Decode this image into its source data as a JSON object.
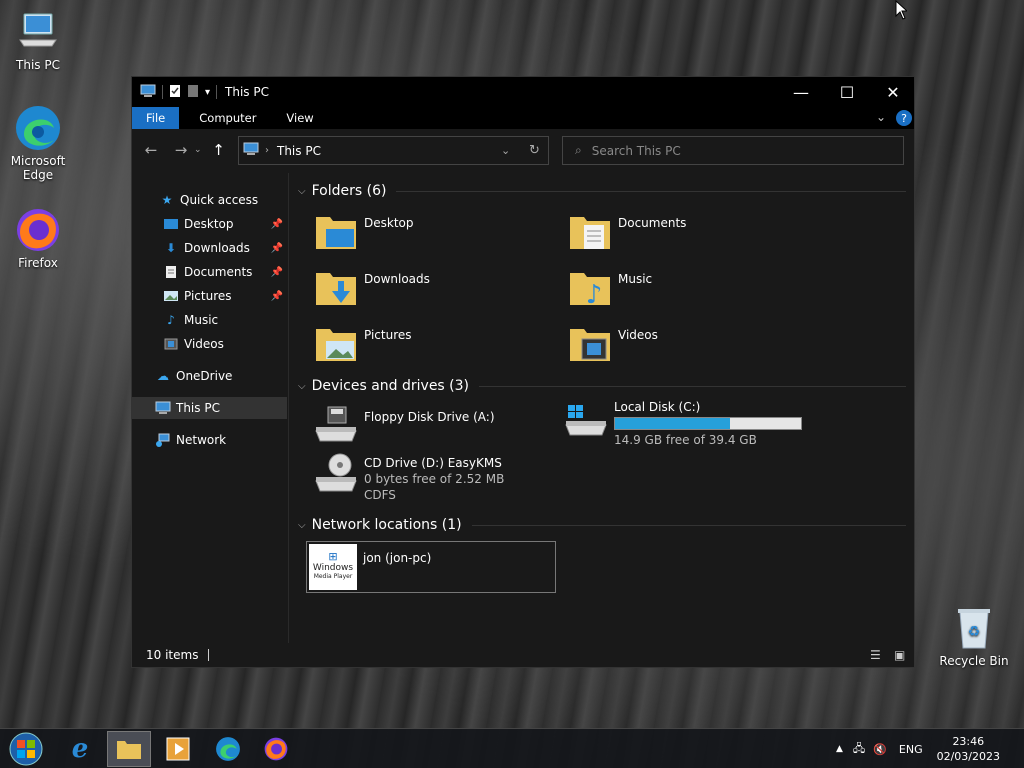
{
  "desktop": {
    "icons": [
      {
        "label": "This PC"
      },
      {
        "label": "Microsoft Edge"
      },
      {
        "label": "Firefox"
      },
      {
        "label": "Recycle Bin"
      }
    ]
  },
  "window": {
    "title": "This PC",
    "tabs": [
      "File",
      "Computer",
      "View"
    ],
    "address": "This PC",
    "search_placeholder": "Search This PC"
  },
  "nav": {
    "quick_access": "Quick access",
    "items": [
      {
        "label": "Desktop",
        "pinned": true
      },
      {
        "label": "Downloads",
        "pinned": true
      },
      {
        "label": "Documents",
        "pinned": true
      },
      {
        "label": "Pictures",
        "pinned": true
      },
      {
        "label": "Music",
        "pinned": false
      },
      {
        "label": "Videos",
        "pinned": false
      }
    ],
    "onedrive": "OneDrive",
    "this_pc": "This PC",
    "network": "Network"
  },
  "content": {
    "folders_header": "Folders (6)",
    "folders": [
      "Desktop",
      "Documents",
      "Downloads",
      "Music",
      "Pictures",
      "Videos"
    ],
    "devices_header": "Devices and drives (3)",
    "devices": [
      {
        "name": "Floppy Disk Drive (A:)"
      },
      {
        "name": "Local Disk (C:)",
        "free": "14.9 GB free of 39.4 GB",
        "used_fraction": 0.62
      },
      {
        "name": "CD Drive (D:) EasyKMS",
        "free": "0 bytes free of 2.52 MB",
        "fs": "CDFS"
      }
    ],
    "network_header": "Network locations (1)",
    "network": [
      {
        "name": "jon (jon-pc)",
        "logo_text": "Windows",
        "logo_sub": "Media Player"
      }
    ]
  },
  "status": {
    "items": "10 items"
  },
  "taskbar": {
    "lang": "ENG",
    "time": "23:46",
    "date": "02/03/2023"
  },
  "colors": {
    "accent": "#1a6fc4",
    "bar_fill": "#26a0da",
    "folder": "#e8c25a"
  }
}
